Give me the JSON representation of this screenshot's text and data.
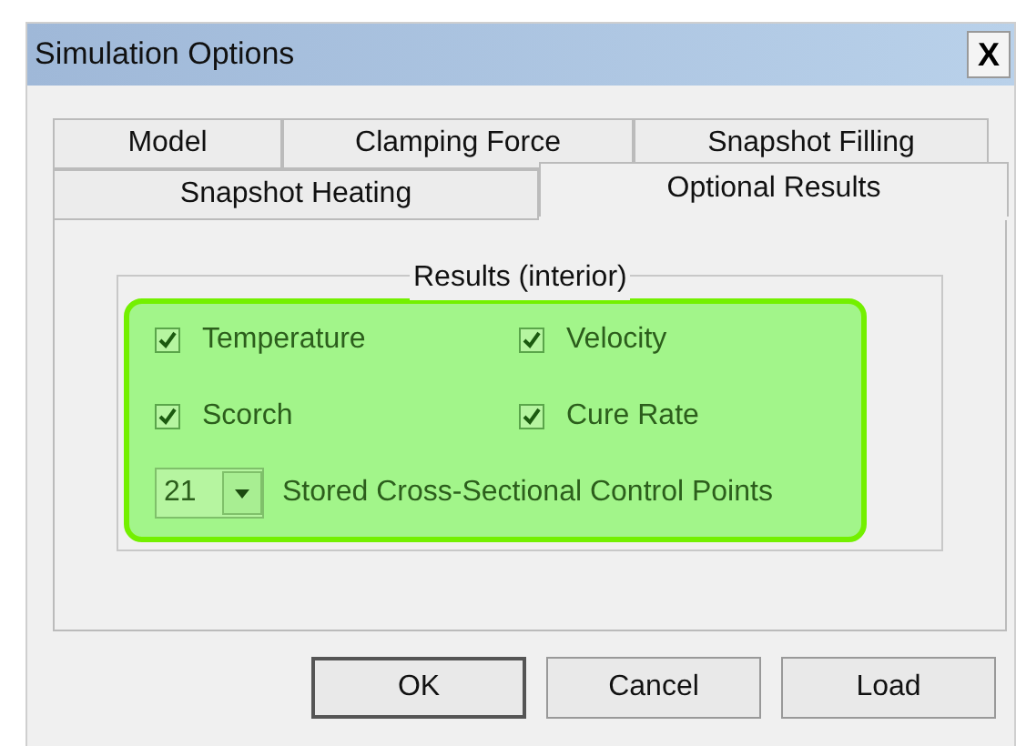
{
  "window": {
    "title": "Simulation Options",
    "close": "X"
  },
  "tab_rows": [
    [
      {
        "label": "Model",
        "selected": false
      },
      {
        "label": "Clamping Force",
        "selected": false
      },
      {
        "label": "Snapshot Filling",
        "selected": false
      }
    ],
    [
      {
        "label": "Snapshot Heating",
        "selected": false
      },
      {
        "label": "Optional Results",
        "selected": true
      }
    ]
  ],
  "group": {
    "title": "Results (interior)",
    "options": [
      {
        "label": "Temperature",
        "checked": true
      },
      {
        "label": "Velocity",
        "checked": true
      },
      {
        "label": "Scorch",
        "checked": true
      },
      {
        "label": "Cure Rate",
        "checked": true
      }
    ],
    "control_points": {
      "value": "21",
      "label": "Stored Cross-Sectional Control Points"
    }
  },
  "buttons": [
    {
      "label": "OK",
      "default": true
    },
    {
      "label": "Cancel",
      "default": false
    },
    {
      "label": "Load",
      "default": false
    }
  ]
}
